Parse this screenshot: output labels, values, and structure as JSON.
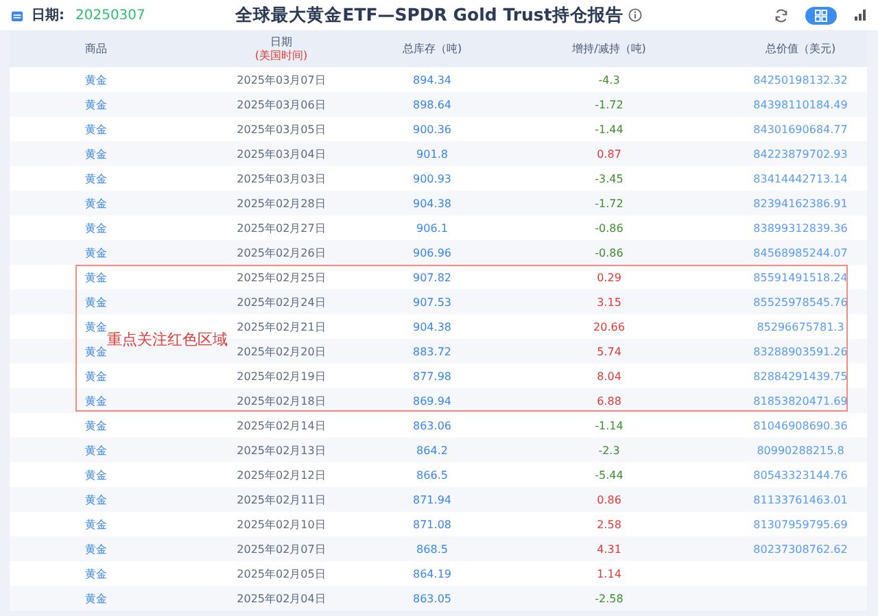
{
  "header": {
    "date_label": "日期:",
    "date_value": "20250307",
    "title": "全球最大黄金ETF—SPDR Gold Trust持仓报告"
  },
  "table": {
    "columns": [
      {
        "label": "商品"
      },
      {
        "label": "日期",
        "sub": "(美国时间)"
      },
      {
        "label": "总库存（吨)"
      },
      {
        "label": "增持/减持（吨)"
      },
      {
        "label": "总价值（美元)"
      }
    ],
    "sections": [
      {
        "highlighted": false,
        "rows": [
          {
            "commodity": "黄金",
            "date": "2025年03月07日",
            "stock": "894.34",
            "change": "-4.3",
            "rising": false,
            "value": "84250198132.32"
          },
          {
            "commodity": "黄金",
            "date": "2025年03月06日",
            "stock": "898.64",
            "change": "-1.72",
            "rising": false,
            "value": "84398110184.49"
          },
          {
            "commodity": "黄金",
            "date": "2025年03月05日",
            "stock": "900.36",
            "change": "-1.44",
            "rising": false,
            "value": "84301690684.77"
          },
          {
            "commodity": "黄金",
            "date": "2025年03月04日",
            "stock": "901.8",
            "change": "0.87",
            "rising": true,
            "value": "84223879702.93"
          },
          {
            "commodity": "黄金",
            "date": "2025年03月03日",
            "stock": "900.93",
            "change": "-3.45",
            "rising": false,
            "value": "83414442713.14"
          },
          {
            "commodity": "黄金",
            "date": "2025年02月28日",
            "stock": "904.38",
            "change": "-1.72",
            "rising": false,
            "value": "82394162386.91"
          },
          {
            "commodity": "黄金",
            "date": "2025年02月27日",
            "stock": "906.1",
            "change": "-0.86",
            "rising": false,
            "value": "83899312839.36"
          },
          {
            "commodity": "黄金",
            "date": "2025年02月26日",
            "stock": "906.96",
            "change": "-0.86",
            "rising": false,
            "value": "84568985244.07"
          }
        ]
      },
      {
        "highlighted": true,
        "note": "重点关注红色区域",
        "rows": [
          {
            "commodity": "黄金",
            "date": "2025年02月25日",
            "stock": "907.82",
            "change": "0.29",
            "rising": true,
            "value": "85591491518.24"
          },
          {
            "commodity": "黄金",
            "date": "2025年02月24日",
            "stock": "907.53",
            "change": "3.15",
            "rising": true,
            "value": "85525978545.76"
          },
          {
            "commodity": "黄金",
            "date": "2025年02月21日",
            "stock": "904.38",
            "change": "20.66",
            "rising": true,
            "value": "85296675781.3"
          },
          {
            "commodity": "黄金",
            "date": "2025年02月20日",
            "stock": "883.72",
            "change": "5.74",
            "rising": true,
            "value": "83288903591.26"
          },
          {
            "commodity": "黄金",
            "date": "2025年02月19日",
            "stock": "877.98",
            "change": "8.04",
            "rising": true,
            "value": "82884291439.75"
          },
          {
            "commodity": "黄金",
            "date": "2025年02月18日",
            "stock": "869.94",
            "change": "6.88",
            "rising": true,
            "value": "81853820471.69"
          }
        ]
      },
      {
        "highlighted": false,
        "rows": [
          {
            "commodity": "黄金",
            "date": "2025年02月14日",
            "stock": "863.06",
            "change": "-1.14",
            "rising": false,
            "value": "81046908690.36"
          },
          {
            "commodity": "黄金",
            "date": "2025年02月13日",
            "stock": "864.2",
            "change": "-2.3",
            "rising": false,
            "value": "80990288215.8"
          },
          {
            "commodity": "黄金",
            "date": "2025年02月12日",
            "stock": "866.5",
            "change": "-5.44",
            "rising": false,
            "value": "80543323144.76"
          },
          {
            "commodity": "黄金",
            "date": "2025年02月11日",
            "stock": "871.94",
            "change": "0.86",
            "rising": true,
            "value": "81133761463.01"
          },
          {
            "commodity": "黄金",
            "date": "2025年02月10日",
            "stock": "871.08",
            "change": "2.58",
            "rising": true,
            "value": "81307959795.69"
          },
          {
            "commodity": "黄金",
            "date": "2025年02月07日",
            "stock": "868.5",
            "change": "4.31",
            "rising": true,
            "value": "80237308762.62"
          },
          {
            "commodity": "黄金",
            "date": "2025年02月05日",
            "stock": "864.19",
            "change": "1.14",
            "rising": true
          },
          {
            "commodity": "黄金",
            "date": "2025年02月04日",
            "stock": "863.05",
            "change": "-2.58",
            "rising": false
          }
        ]
      }
    ]
  }
}
